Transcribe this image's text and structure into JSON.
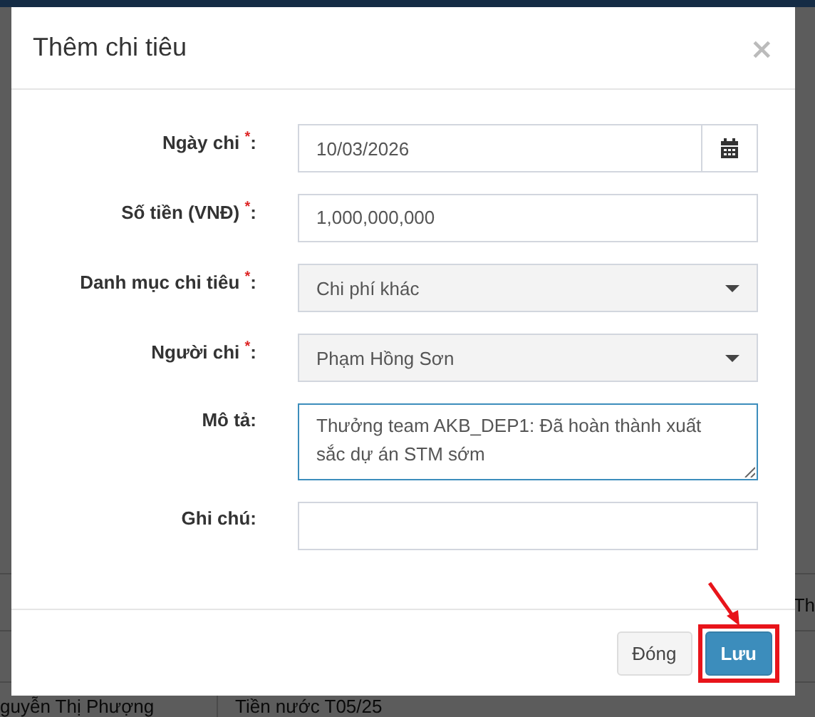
{
  "background_table": {
    "rows": [
      {
        "cells": [
          "",
          "Th"
        ]
      },
      {
        "cells": [
          "guyễn Thị Phượng",
          "Tiền nước T05/25"
        ]
      }
    ]
  },
  "modal": {
    "title": "Thêm chi tiêu",
    "close": "×",
    "fields": [
      {
        "kind": "date",
        "label": "Ngày chi $^{*}$:",
        "value": "10/03/2026",
        "focused": false
      },
      {
        "kind": "text",
        "label": "Số tiền (VNĐ) $^{*}$:",
        "value": "1,000,000,000",
        "focused": false
      },
      {
        "kind": "select",
        "label": "Danh mục chi tiêu $^{*}$:",
        "value": "Chi phí khác",
        "focused": false
      },
      {
        "kind": "select",
        "label": "Người chi $^{*}$:",
        "value": "Phạm Hồng Sơn",
        "focused": false
      },
      {
        "kind": "textarea",
        "label": "Mô tả:",
        "value": "Thưởng team AKB_DEP1: Đã hoàn thành xuất sắc dự án STM sớm",
        "focused": true
      },
      {
        "kind": "text",
        "label": "Ghi chú:",
        "focused": false
      }
    ],
    "buttons": [
      {
        "label": "Đóng",
        "kind": "default",
        "highlighted": false
      },
      {
        "label": "Lưu",
        "kind": "primary",
        "highlighted": true
      }
    ]
  }
}
